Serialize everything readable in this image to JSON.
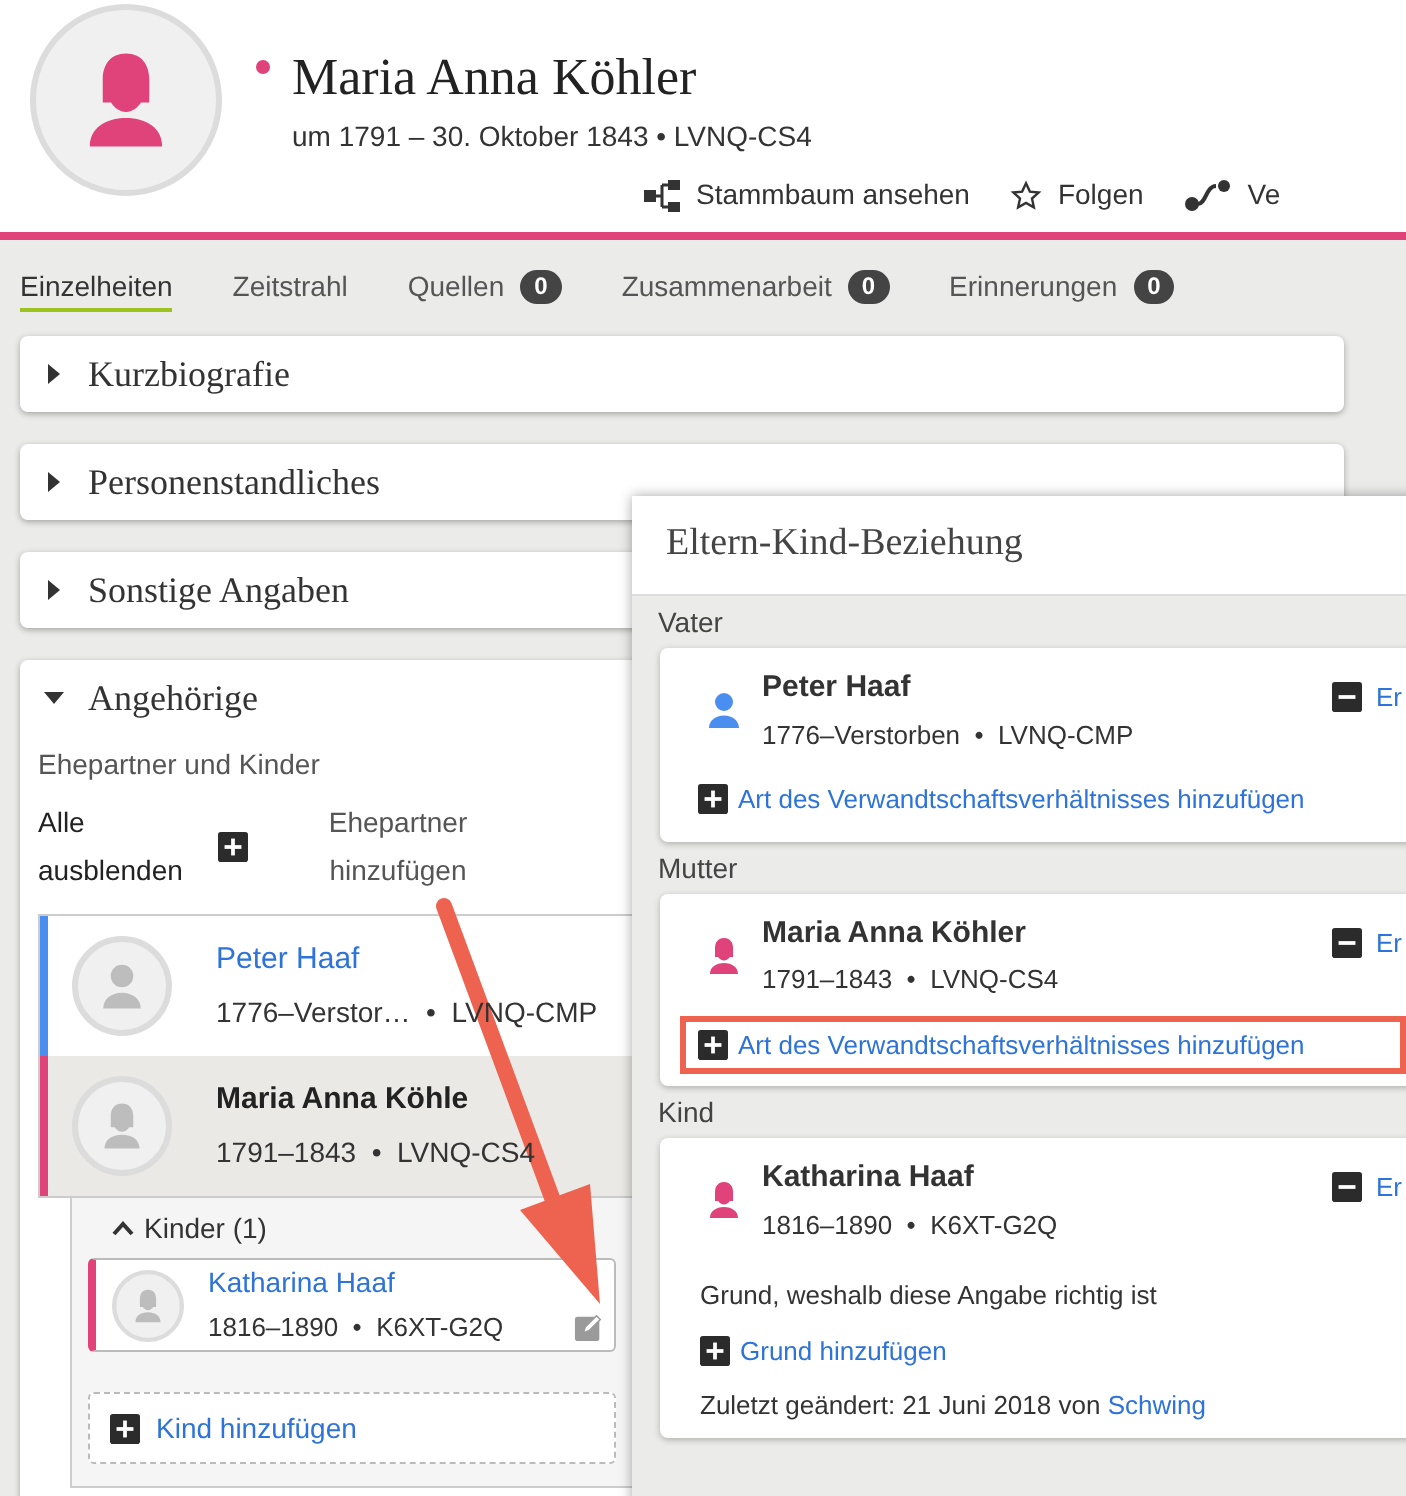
{
  "person": {
    "name": "Maria Anna Köhler",
    "kind": "female",
    "color": "#e0427a",
    "meta": "um 1791 – 30. Oktober 1843 • LVNQ-CS4"
  },
  "actions": [
    {
      "kind": "tree",
      "label": "Stammbaum ansehen"
    },
    {
      "kind": "star",
      "label": "Folgen"
    },
    {
      "kind": "relation",
      "label": "Ve"
    }
  ],
  "tabs": [
    {
      "label": "Einzelheiten",
      "selected": true
    },
    {
      "label": "Zeitstrahl",
      "selected": false
    },
    {
      "label": "Quellen",
      "count": "0",
      "selected": false
    },
    {
      "label": "Zusammenarbeit",
      "count": "0",
      "selected": false
    },
    {
      "label": "Erinnerungen",
      "count": "0",
      "selected": false
    }
  ],
  "sections": [
    {
      "title": "Kurzbiografie",
      "expanded": false
    },
    {
      "title": "Personenstandliches",
      "expanded": false
    },
    {
      "title": "Sonstige Angaben",
      "expanded": false
    }
  ],
  "family": {
    "title": "Angehörige",
    "expanded": true,
    "heading": "Ehepartner und Kinder",
    "hide_all": "Alle ausblenden",
    "add_spouse": "Ehepartner hinzufügen",
    "couple": [
      {
        "name": "Peter Haaf",
        "kind": "male",
        "color": "#4a8ff0",
        "meta": "1776–Verstor…  •  LVNQ-CMP",
        "current": false
      },
      {
        "name": "Maria Anna Köhle",
        "kind": "female",
        "color": "#e0427a",
        "meta": "1791–1843  •  LVNQ-CS4",
        "current": true
      }
    ],
    "children_toggle": "Kinder (1)",
    "children_expanded": true,
    "children": [
      {
        "name": "Katharina Haaf",
        "kind": "female",
        "color": "#e0427a",
        "meta": "1816–1890  •  K6XT-G2Q"
      }
    ],
    "add_child": "Kind hinzufügen"
  },
  "popover": {
    "title": "Eltern-Kind-Beziehung",
    "roles": [
      {
        "label": "Vater",
        "name": "Peter Haaf",
        "kind": "male",
        "color": "#4a8ff0",
        "meta": "1776–Verstorben  •  LVNQ-CMP",
        "remove": "Er",
        "add_type": "Art des Verwandtschaftsverhältnisses hinzufügen",
        "highlighted": false
      },
      {
        "label": "Mutter",
        "name": "Maria Anna Köhler",
        "kind": "female",
        "color": "#e0427a",
        "meta": "1791–1843  •  LVNQ-CS4",
        "remove": "Er",
        "add_type": "Art des Verwandtschaftsverhältnisses hinzufügen",
        "highlighted": true
      },
      {
        "label": "Kind",
        "name": "Katharina Haaf",
        "kind": "female",
        "color": "#e0427a",
        "meta": "1816–1890  •  K6XT-G2Q",
        "remove": "Er",
        "reason_label": "Grund, weshalb diese Angabe richtig ist",
        "add_reason": "Grund hinzufügen",
        "changed": "Zuletzt geändert: 21 Juni 2018 von",
        "changed_by": "Schwing"
      }
    ]
  }
}
